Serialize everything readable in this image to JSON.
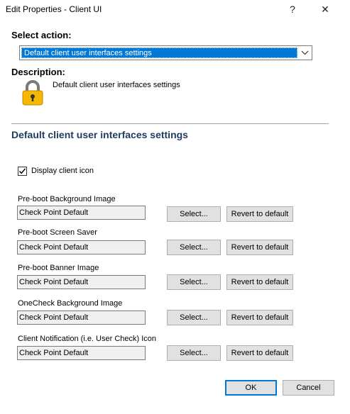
{
  "window": {
    "title": "Edit Properties - Client UI",
    "help_glyph": "?",
    "close_glyph": "✕"
  },
  "action": {
    "label": "Select action:",
    "selected": "Default client user interfaces settings"
  },
  "description": {
    "label": "Description:",
    "text": "Default client user interfaces settings",
    "icon": "lock-icon"
  },
  "section": {
    "title": "Default client user interfaces settings"
  },
  "display_client_icon": {
    "label": "Display client icon",
    "checked": true
  },
  "fields": [
    {
      "label": "Pre-boot Background Image",
      "value": "Check Point Default",
      "select_label": "Select...",
      "revert_label": "Revert to default"
    },
    {
      "label": "Pre-boot Screen Saver",
      "value": "Check Point Default",
      "select_label": "Select...",
      "revert_label": "Revert to default"
    },
    {
      "label": "Pre-boot Banner Image",
      "value": "Check Point Default",
      "select_label": "Select...",
      "revert_label": "Revert to default"
    },
    {
      "label": "OneCheck Background Image",
      "value": "Check Point Default",
      "select_label": "Select...",
      "revert_label": "Revert to default"
    },
    {
      "label": "Client Notification (i.e. User Check) Icon",
      "value": "Check Point Default",
      "select_label": "Select...",
      "revert_label": "Revert to default"
    }
  ],
  "footer": {
    "ok_label": "OK",
    "cancel_label": "Cancel"
  },
  "colors": {
    "accent": "#0078d7",
    "section_title": "#1f3a5f",
    "lock_body": "#f5b800"
  }
}
